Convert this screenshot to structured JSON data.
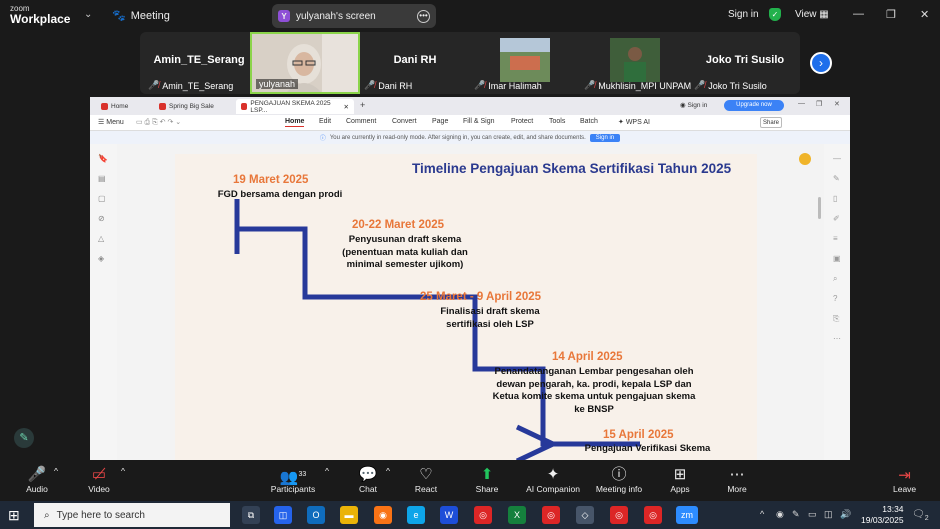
{
  "topbar": {
    "logo_line1": "zoom",
    "logo_line2": "Workplace",
    "meeting_label": "Meeting",
    "share_initial": "Y",
    "share_label": "yulyanah's screen",
    "signin": "Sign in",
    "view": "View"
  },
  "participants": [
    {
      "name": "Amin_TE_Serang",
      "label": "Amin_TE_Serang"
    },
    {
      "name": "",
      "label": "yulyanah"
    },
    {
      "name": "Dani RH",
      "label": "Dani RH"
    },
    {
      "name": "",
      "label": "Imar Halimah"
    },
    {
      "name": "",
      "label": "Mukhlisin_MPI UNPAM"
    },
    {
      "name": "Joko Tri Susilo",
      "label": "Joko Tri Susilo"
    }
  ],
  "wps": {
    "tabs": [
      "Home",
      "Spring Big Sale",
      "PENGAJUAN SKEMA 2025 LSP..."
    ],
    "menu": [
      "Menu",
      "Home",
      "Edit",
      "Comment",
      "Convert",
      "Page",
      "Fill & Sign",
      "Protect",
      "Tools",
      "Batch",
      "WPS AI"
    ],
    "signin": "Sign in",
    "upgrade": "Upgrade now",
    "share": "Share",
    "readonly_msg": "You are currently in read-only mode. After signing in, you can create, edit, and share documents.",
    "readonly_btn": "Sign in"
  },
  "slide": {
    "title": "Timeline Pengajuan Skema Sertifikasi Tahun 2025",
    "events": [
      {
        "date": "19 Maret 2025",
        "lines": [
          "FGD bersama dengan prodi"
        ]
      },
      {
        "date": "20-22 Maret 2025",
        "lines": [
          "Penyusunan draft skema",
          "(penentuan mata kuliah dan",
          "minimal semester ujikom)"
        ]
      },
      {
        "date": "25 Maret - 9 April 2025",
        "lines": [
          "Finalisasi draft skema",
          "sertifikasi oleh LSP"
        ]
      },
      {
        "date": "14 April 2025",
        "lines": [
          "Penandatanganan Lembar pengesahan oleh",
          "dewan pengarah, ka. prodi, kepala LSP dan",
          "Ketua komite skema untuk  pengajuan skema",
          "ke BNSP"
        ]
      },
      {
        "date": "15 April 2025",
        "lines": [
          "Pengajuan Verifikasi Skema"
        ]
      }
    ]
  },
  "toolbar": {
    "audio": "Audio",
    "video": "Video",
    "participants": "Participants",
    "participants_count": "33",
    "chat": "Chat",
    "react": "React",
    "share": "Share",
    "ai": "AI Companion",
    "info": "Meeting info",
    "apps": "Apps",
    "more": "More",
    "leave": "Leave"
  },
  "taskbar": {
    "search_placeholder": "Type here to search",
    "time": "13:34",
    "date": "19/03/2025",
    "notif_count": "2"
  },
  "colors": {
    "slide_title": "#2b3a8f",
    "date_orange": "#e8773a",
    "arrow_blue": "#27399a",
    "zoom_blue": "#1f6feb"
  }
}
